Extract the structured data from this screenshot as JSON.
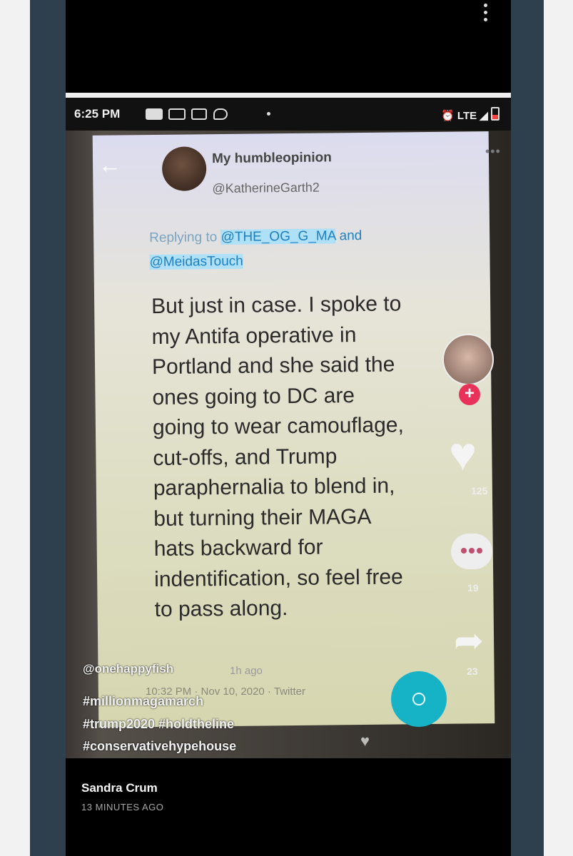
{
  "status_bar": {
    "time": "6:25 PM",
    "network": "LTE"
  },
  "tweet": {
    "display_name": "My humbleopinion",
    "handle": "@KatherineGarth2",
    "replying_label": "Replying to",
    "replying_mention1": "@THE_OG_G_MA",
    "replying_and": "and",
    "replying_mention2": "@MeidasTouch",
    "lines": [
      "But just in case. I spoke to",
      "my Antifa operative in",
      "Portland and she said the",
      "ones going to DC  are",
      "going to wear camouflage,",
      "cut-offs, and Trump",
      "paraphernalia to blend in,",
      "but turning their MAGA",
      "hats backward for",
      "indentification, so feel free",
      "to pass along."
    ],
    "timestamp": "10:32 PM · Nov 10, 2020 · Twitter"
  },
  "tiktok": {
    "username": "@onehappyfish",
    "time_ago": "1h ago",
    "hashtags1": "#millionmagamarch",
    "hashtags2": "#trump2020 #holdtheline",
    "hashtags3": "#conservativehypehouse",
    "like_count": "125",
    "comment_count": "19",
    "share_count": "23",
    "colors": {
      "follow": "#e8325a",
      "record": "#16b2c6"
    }
  },
  "post": {
    "author": "Sandra Crum",
    "posted_time": "13 MINUTES AGO"
  }
}
